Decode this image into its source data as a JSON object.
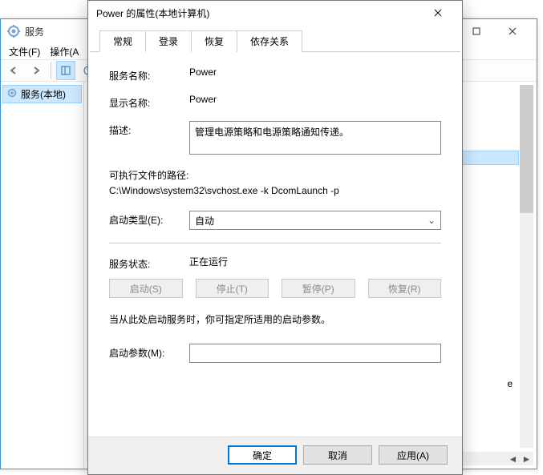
{
  "mmc": {
    "title": "服务",
    "menu": {
      "file": "文件(F)",
      "action": "操作(A"
    },
    "tree_item": "服务(本地)",
    "main_note": "e",
    "toolbar": [
      "back",
      "forward",
      "|",
      "view-list",
      "help"
    ]
  },
  "dlg": {
    "title": "Power 的属性(本地计算机)",
    "tabs": {
      "general": "常规",
      "logon": "登录",
      "recovery": "恢复",
      "dependencies": "依存关系"
    },
    "labels": {
      "service_name": "服务名称:",
      "display_name": "显示名称:",
      "description": "描述:",
      "exe_path": "可执行文件的路径:",
      "startup_type": "启动类型(E):",
      "service_status": "服务状态:",
      "start_params": "启动参数(M):"
    },
    "values": {
      "service_name": "Power",
      "display_name": "Power",
      "description": "管理电源策略和电源策略通知传递。",
      "exe_path": "C:\\Windows\\system32\\svchost.exe -k DcomLaunch -p",
      "startup_type": "自动",
      "service_status": "正在运行",
      "start_params": ""
    },
    "svc_buttons": {
      "start": "启动(S)",
      "stop": "停止(T)",
      "pause": "暂停(P)",
      "resume": "恢复(R)"
    },
    "hint": "当从此处启动服务时，你可指定所适用的启动参数。",
    "footer": {
      "ok": "确定",
      "cancel": "取消",
      "apply": "应用(A)"
    }
  }
}
